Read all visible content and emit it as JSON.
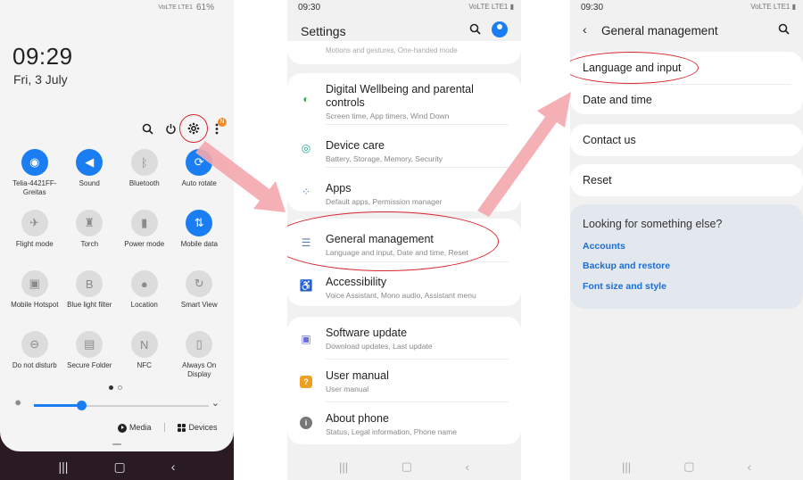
{
  "colors": {
    "accent": "#1a7ef2",
    "highlight_ring": "#d6262e",
    "arrow": "#f4a7ae",
    "link": "#1a6ed4"
  },
  "quick_panel": {
    "status": {
      "network": "VoLTE LTE1",
      "battery": "61%"
    },
    "time": "09:29",
    "date": "Fri, 3 July",
    "top_icons": [
      "search-icon",
      "power-icon",
      "gear-icon",
      "more-icon"
    ],
    "notification_badge": "N",
    "tiles": [
      {
        "label": "Telia-4421FF-Greitas",
        "icon": "wifi-icon",
        "glyph": "◉",
        "on": true
      },
      {
        "label": "Sound",
        "icon": "sound-icon",
        "glyph": "◀",
        "on": true
      },
      {
        "label": "Bluetooth",
        "icon": "bluetooth-icon",
        "glyph": "ᛒ",
        "on": false
      },
      {
        "label": "Auto rotate",
        "icon": "auto-rotate-icon",
        "glyph": "⟳",
        "on": true
      },
      {
        "label": "Flight mode",
        "icon": "airplane-icon",
        "glyph": "✈",
        "on": false
      },
      {
        "label": "Torch",
        "icon": "torch-icon",
        "glyph": "♜",
        "on": false
      },
      {
        "label": "Power mode",
        "icon": "battery-icon",
        "glyph": "▮",
        "on": false
      },
      {
        "label": "Mobile data",
        "icon": "mobile-data-icon",
        "glyph": "⇅",
        "on": true
      },
      {
        "label": "Mobile Hotspot",
        "icon": "hotspot-icon",
        "glyph": "▣",
        "on": false
      },
      {
        "label": "Blue light filter",
        "icon": "blue-light-icon",
        "glyph": "B",
        "on": false
      },
      {
        "label": "Location",
        "icon": "location-icon",
        "glyph": "●",
        "on": false
      },
      {
        "label": "Smart View",
        "icon": "smart-view-icon",
        "glyph": "↻",
        "on": false
      },
      {
        "label": "Do not disturb",
        "icon": "do-not-disturb-icon",
        "glyph": "⊖",
        "on": false
      },
      {
        "label": "Secure Folder",
        "icon": "secure-folder-icon",
        "glyph": "▤",
        "on": false
      },
      {
        "label": "NFC",
        "icon": "nfc-icon",
        "glyph": "N",
        "on": false
      },
      {
        "label": "Always On Display",
        "icon": "always-on-display-icon",
        "glyph": "▯",
        "on": false
      }
    ],
    "brightness_level": 0.27,
    "media_label": "Media",
    "devices_label": "Devices"
  },
  "settings": {
    "time": "09:30",
    "status": "VoLTE LTE1 ▮",
    "title": "Settings",
    "partial_row": "Motions and gestures, One-handed mode",
    "cards": [
      {
        "rows": [
          {
            "title": "Digital Wellbeing and parental controls",
            "subtitle": "Screen time, App timers, Wind Down",
            "icon": "digital-wellbeing-icon",
            "glyph": "◐",
            "color": "#34a853"
          },
          {
            "title": "Device care",
            "subtitle": "Battery, Storage, Memory, Security",
            "icon": "device-care-icon",
            "glyph": "◎",
            "color": "#1aa88c"
          },
          {
            "title": "Apps",
            "subtitle": "Default apps, Permission manager",
            "icon": "apps-icon",
            "glyph": "⁘",
            "color": "#4a7ee8"
          }
        ]
      },
      {
        "rows": [
          {
            "title": "General management",
            "subtitle": "Language and input, Date and time, Reset",
            "icon": "general-management-icon",
            "glyph": "☰",
            "color": "#5a7fa6"
          },
          {
            "title": "Accessibility",
            "subtitle": "Voice Assistant, Mono audio, Assistant menu",
            "icon": "accessibility-icon",
            "glyph": "♿",
            "color": "#2e9e4a"
          }
        ]
      },
      {
        "rows": [
          {
            "title": "Software update",
            "subtitle": "Download updates, Last update",
            "icon": "software-update-icon",
            "glyph": "▣",
            "color": "#6a6fe0"
          },
          {
            "title": "User manual",
            "subtitle": "User manual",
            "icon": "user-manual-icon",
            "glyph": "?",
            "color": "#f0a020"
          },
          {
            "title": "About phone",
            "subtitle": "Status, Legal information, Phone name",
            "icon": "about-phone-icon",
            "glyph": "i",
            "color": "#777777"
          }
        ]
      }
    ]
  },
  "general_management": {
    "time": "09:30",
    "status": "VoLTE LTE1 ▮",
    "title": "General management",
    "items": [
      "Language and input",
      "Date and time",
      "Contact us",
      "Reset"
    ],
    "looking": {
      "title": "Looking for something else?",
      "links": [
        "Accounts",
        "Backup and restore",
        "Font size and style"
      ]
    }
  },
  "nav_icons": [
    "recents-icon",
    "home-icon",
    "back-icon"
  ]
}
